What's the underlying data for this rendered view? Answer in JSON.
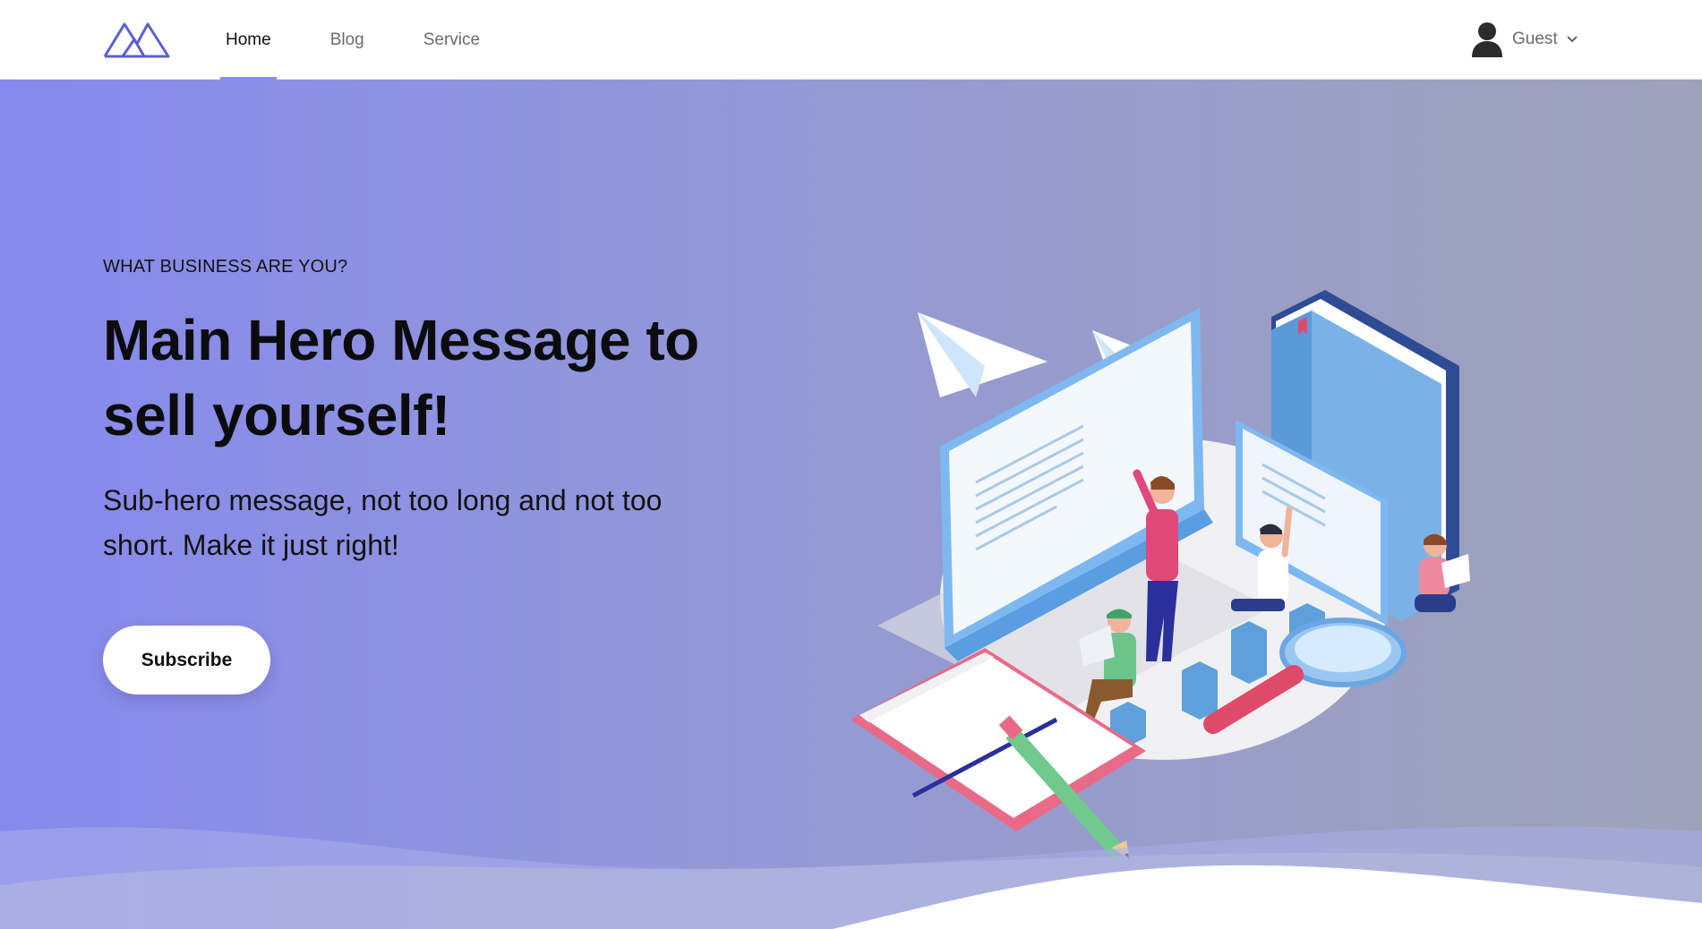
{
  "nav": {
    "logo_icon": "mountains-logo-icon",
    "items": [
      {
        "label": "Home",
        "active": true
      },
      {
        "label": "Blog",
        "active": false
      },
      {
        "label": "Service",
        "active": false
      }
    ],
    "user": {
      "label": "Guest",
      "icon": "user-avatar-icon",
      "dropdown_icon": "chevron-down-icon"
    }
  },
  "hero": {
    "eyebrow": "WHAT BUSINESS ARE YOU?",
    "headline_line1": "Main Hero Message to",
    "headline_line2": "sell yourself!",
    "subhead_line1": "Sub-hero message, not too long and not too",
    "subhead_line2": "short. Make it just right!",
    "cta_label": "Subscribe",
    "illustration": "isometric-team-working-illustration"
  },
  "colors": {
    "accent": "#8c8cf0",
    "logo": "#5b5fd6",
    "hero_gradient_start": "#8789ee",
    "hero_gradient_end": "#9ea2b9",
    "text_dark": "#111111",
    "nav_muted": "#6b6b72"
  }
}
